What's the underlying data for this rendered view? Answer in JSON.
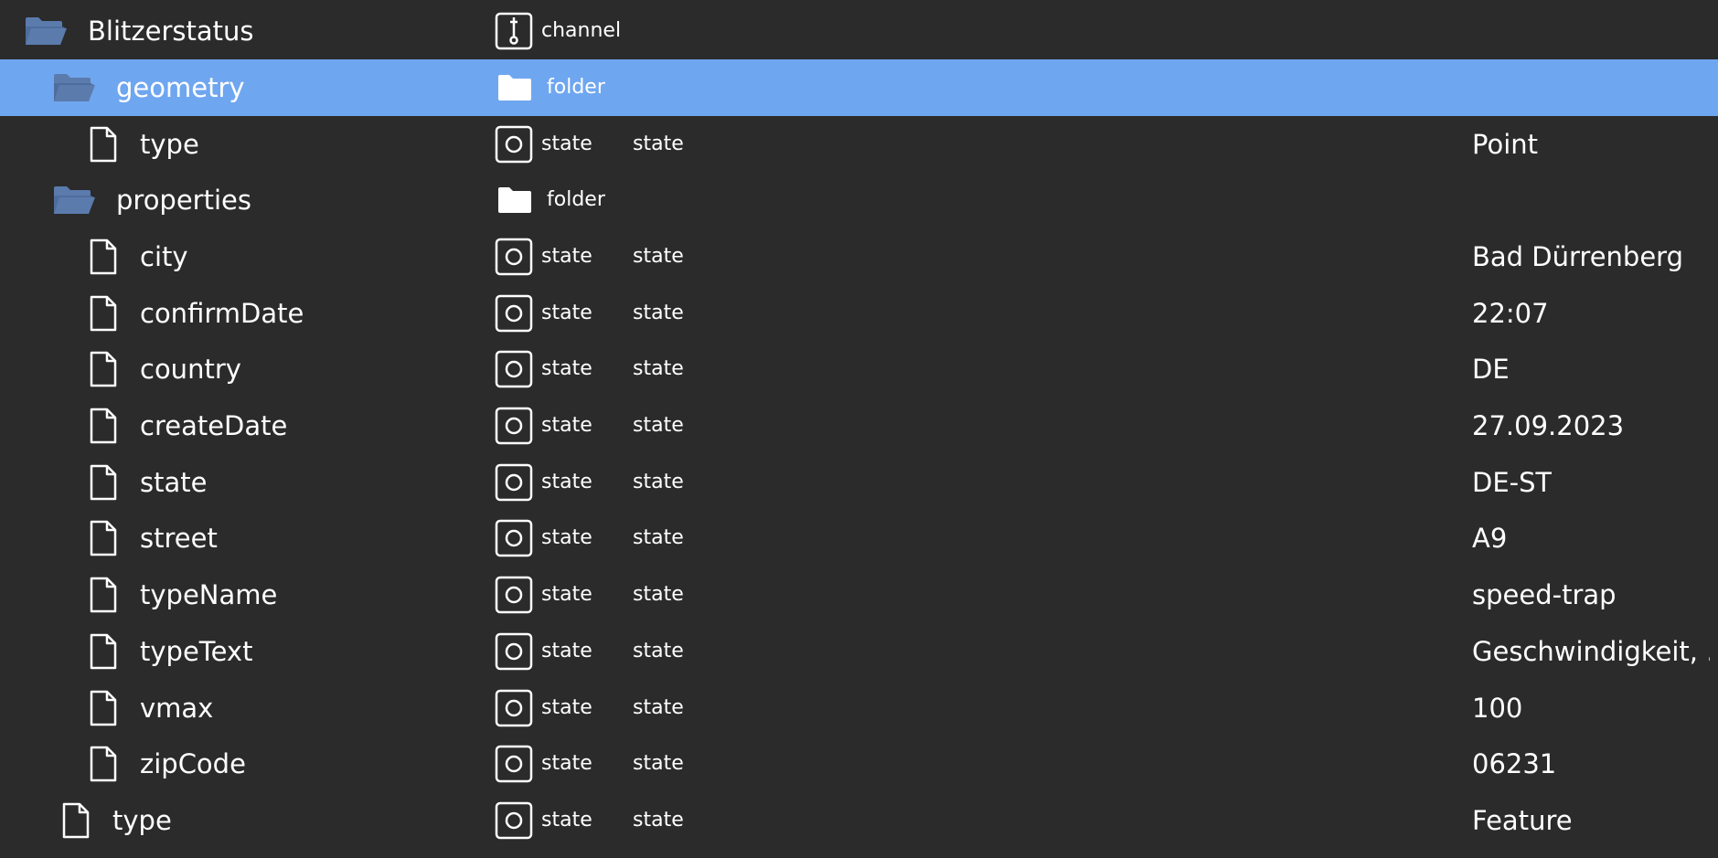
{
  "tree": {
    "root": {
      "name": "Blitzerstatus",
      "kind": "channel",
      "tree_icon": "folder-open-icon",
      "type_icon": "channel-icon"
    },
    "geometry": {
      "name": "geometry",
      "kind": "folder",
      "selected": true,
      "tree_icon": "folder-open-icon",
      "type_icon": "folder-icon",
      "children": [
        {
          "name": "type",
          "kind": "state",
          "role": "state",
          "value": "Point"
        }
      ]
    },
    "properties": {
      "name": "properties",
      "kind": "folder",
      "tree_icon": "folder-open-icon",
      "type_icon": "folder-icon",
      "children": [
        {
          "name": "city",
          "kind": "state",
          "role": "state",
          "value": "Bad Dürrenberg"
        },
        {
          "name": "confirmDate",
          "kind": "state",
          "role": "state",
          "value": "22:07"
        },
        {
          "name": "country",
          "kind": "state",
          "role": "state",
          "value": "DE"
        },
        {
          "name": "createDate",
          "kind": "state",
          "role": "state",
          "value": "27.09.2023"
        },
        {
          "name": "state",
          "kind": "state",
          "role": "state",
          "value": "DE-ST"
        },
        {
          "name": "street",
          "kind": "state",
          "role": "state",
          "value": "A9"
        },
        {
          "name": "typeName",
          "kind": "state",
          "role": "state",
          "value": "speed-trap"
        },
        {
          "name": "typeText",
          "kind": "state",
          "role": "state",
          "value": "Geschwindigkeit, ..."
        },
        {
          "name": "vmax",
          "kind": "state",
          "role": "state",
          "value": "100"
        },
        {
          "name": "zipCode",
          "kind": "state",
          "role": "state",
          "value": "06231"
        }
      ]
    },
    "type": {
      "name": "type",
      "kind": "state",
      "role": "state",
      "value": "Feature"
    }
  },
  "colors": {
    "background": "#2b2b2b",
    "selected_row": "#6fa6f0",
    "folder_icon": "#5b7bad",
    "text": "#ffffff"
  }
}
